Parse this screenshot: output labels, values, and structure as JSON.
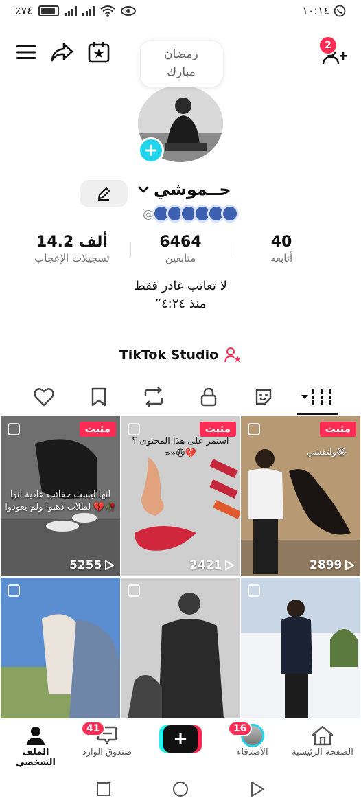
{
  "status_bar": {
    "time": "١٠:١٤",
    "battery": "٪٧٤"
  },
  "top_bar": {
    "follow_requests_badge": "2"
  },
  "profile": {
    "bubble_line1": "رمضان",
    "bubble_line2": "مبارك",
    "display_name": "حــموشي",
    "username": "@",
    "stats": {
      "likes_value": "14.2 ألف",
      "likes_label": "تسجيلات الإعجاب",
      "followers_value": "6464",
      "followers_label": "متابعين",
      "following_value": "40",
      "following_label": "أتابعه"
    },
    "bio": "لا تعاتب غادر فقط",
    "bio_time": "ˮمنذ ٤:٢٤"
  },
  "studio": {
    "label": "TikTok Studio"
  },
  "videos": [
    {
      "pinned": "مثبت",
      "views": "5255",
      "caption": "انها ليست حقائب عادية انها لطلاب ذهبوا ولم يعودوا 💔🥀"
    },
    {
      "pinned": "مثبت",
      "views": "2421",
      "caption": "استمر على هذا المحتوى ؟ »»😩💔"
    },
    {
      "pinned": "مثبت",
      "views": "2899",
      "caption": "ولتقشي😂"
    },
    {
      "pinned": "",
      "views": "",
      "caption": ""
    },
    {
      "pinned": "",
      "views": "",
      "caption": ""
    },
    {
      "pinned": "",
      "views": "",
      "caption": ""
    }
  ],
  "bottom_nav": {
    "profile": "الملف الشخصي",
    "inbox": "صندوق الوارد",
    "inbox_badge": "41",
    "friends": "الأصدقاء",
    "friends_badge": "16",
    "home": "الصفحة الرئيسية"
  },
  "colors": {
    "accent": "#fe2c55",
    "cyan": "#20d5ec"
  }
}
